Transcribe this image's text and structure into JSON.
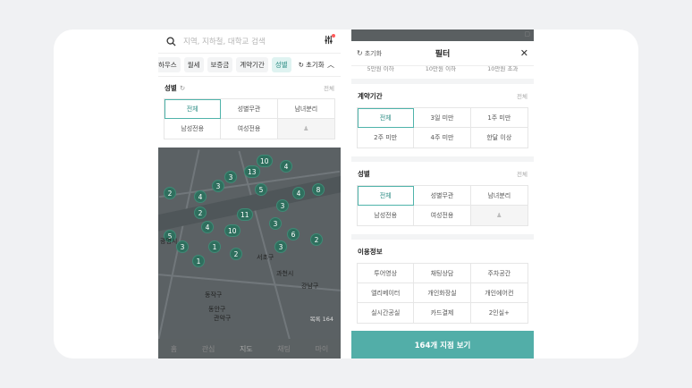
{
  "left": {
    "search": {
      "placeholder": "지역, 지하철, 대학교 검색"
    },
    "chips": [
      {
        "label": "하우스",
        "active": false
      },
      {
        "label": "월세",
        "active": false
      },
      {
        "label": "보증금",
        "active": false
      },
      {
        "label": "계약기간",
        "active": false
      },
      {
        "label": "성별",
        "active": true
      }
    ],
    "reset_label": "초기화",
    "gender": {
      "title": "성별",
      "all_label": "전체",
      "options": [
        "전체",
        "성별무관",
        "남녀분리",
        "남성전용",
        "여성전용",
        ""
      ],
      "selected_index": 0
    },
    "map": {
      "labels": [
        "광명시",
        "동작구",
        "관악구",
        "동안구",
        "과천시",
        "강남구",
        "서초구"
      ],
      "clusters": [
        "10",
        "13",
        "3",
        "4",
        "3",
        "8",
        "4",
        "5",
        "2",
        "4",
        "3",
        "10",
        "11",
        "2",
        "4",
        "5",
        "3",
        "1",
        "3",
        "2",
        "3",
        "1",
        "6",
        "2"
      ],
      "badge": "목록 164"
    },
    "tabbar": [
      "홈",
      "관심",
      "지도",
      "채팅",
      "마이"
    ]
  },
  "right": {
    "header": {
      "reset_label": "초기화",
      "title": "필터"
    },
    "prev_row": [
      "5만원 이하",
      "10만원 이하",
      "10만원 초과"
    ],
    "contract": {
      "title": "계약기간",
      "all_label": "전체",
      "options": [
        "전체",
        "3일 미만",
        "1주 미만",
        "2주 미만",
        "4주 미만",
        "한달 이상"
      ],
      "selected_index": 0
    },
    "gender": {
      "title": "성별",
      "all_label": "전체",
      "options": [
        "전체",
        "성별무관",
        "남녀분리",
        "남성전용",
        "여성전용",
        ""
      ],
      "selected_index": 0
    },
    "usage": {
      "title": "이용정보",
      "options": [
        "투어영상",
        "채팅상담",
        "주차공간",
        "엘리베이터",
        "개인화장실",
        "개인에어컨",
        "실시간공실",
        "카드결제",
        "2인실+"
      ]
    },
    "cta_label": "164개 지점 보기"
  },
  "colors": {
    "accent": "#52aea8",
    "accent_text": "#2a8b83",
    "chip_active_bg": "#dff3f1",
    "map_cluster": "#2f6f5e"
  }
}
